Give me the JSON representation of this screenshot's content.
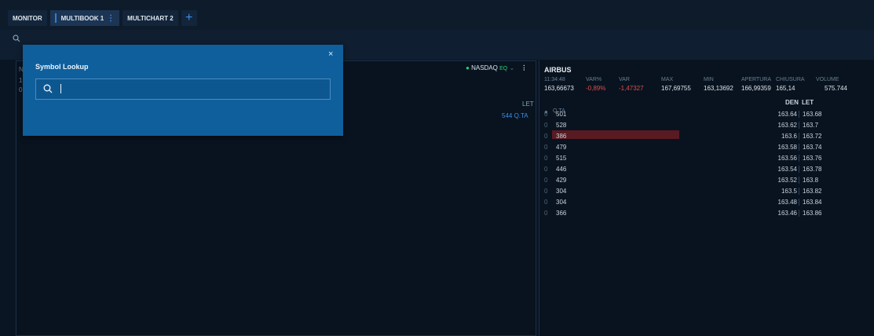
{
  "tabs": [
    {
      "label": "MONITOR",
      "active": false
    },
    {
      "label": "MULTIBOOK 1",
      "active": true
    },
    {
      "label": "MULTICHART 2",
      "active": false
    }
  ],
  "tab_add_label": "+",
  "left_panel": {
    "market": "NASDAQ",
    "market_type": "EQ",
    "column_let": "LET",
    "qty_value": "544 Q.TA",
    "fragments": [
      "N",
      "1",
      "0",
      "",
      ""
    ]
  },
  "quote": {
    "symbol": "AIRBUS",
    "labels": [
      "11:34:48",
      "VAR%",
      "VAR",
      "MAX",
      "MIN",
      "APERTURA",
      "CHIUSURA",
      "VOLUME"
    ],
    "values": [
      "163,66673",
      "-0,89%",
      "-1,47327",
      "167,69755",
      "163,13692",
      "166,99359",
      "165,14",
      "575.744"
    ]
  },
  "book": {
    "qta_header": "Q.TA",
    "den_header": "DEN",
    "let_header": "LET",
    "rows": [
      {
        "zero": "0",
        "qty": "501",
        "den": "163.64",
        "let": "163.68"
      },
      {
        "zero": "0",
        "qty": "528",
        "den": "163.62",
        "let": "163.7"
      },
      {
        "zero": "0",
        "qty": "386",
        "den": "163.6",
        "let": "163.72"
      },
      {
        "zero": "0",
        "qty": "479",
        "den": "163.58",
        "let": "163.74"
      },
      {
        "zero": "0",
        "qty": "515",
        "den": "163.56",
        "let": "163.76"
      },
      {
        "zero": "0",
        "qty": "446",
        "den": "163.54",
        "let": "163.78"
      },
      {
        "zero": "0",
        "qty": "429",
        "den": "163.52",
        "let": "163.8"
      },
      {
        "zero": "0",
        "qty": "304",
        "den": "163.5",
        "let": "163.82"
      },
      {
        "zero": "0",
        "qty": "304",
        "den": "163.48",
        "let": "163.84"
      },
      {
        "zero": "0",
        "qty": "366",
        "den": "163.46",
        "let": "163.86"
      }
    ]
  },
  "modal": {
    "title": "Symbol Lookup",
    "close": "×",
    "search_value": ""
  },
  "colors": {
    "accent": "#3a8ee8",
    "modal_bg": "#0f5f9c",
    "negative": "#e04a4a",
    "highlight": "#5a1a22",
    "positive": "#2ecc71"
  }
}
